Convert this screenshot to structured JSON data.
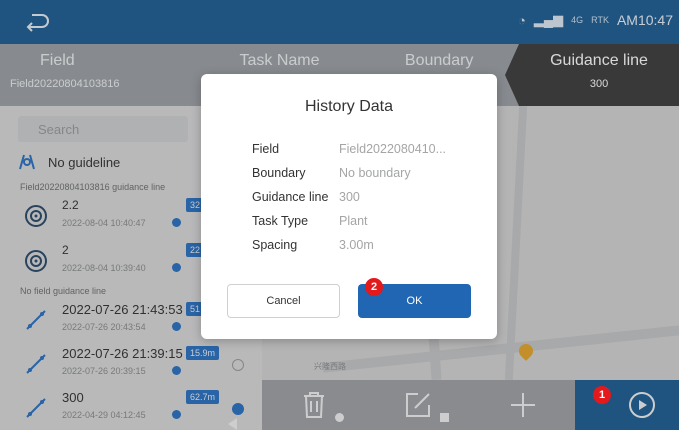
{
  "status": {
    "time": "AM10:47",
    "sig1": "4G",
    "sig2": "RTK"
  },
  "tabs": [
    {
      "label": "Field",
      "value": "Field20220804103816"
    },
    {
      "label": "Task Name",
      "value": ""
    },
    {
      "label": "Boundary",
      "value": ""
    },
    {
      "label": "Guidance line",
      "value": "300"
    }
  ],
  "left": {
    "search_placeholder": "Search",
    "no_guideline": "No guideline",
    "group1": "Field20220804103816 guidance line",
    "group2": "No field guidance line",
    "items": [
      {
        "name": "2.2",
        "date": "2022-08-04 10:40:47",
        "badge": "32"
      },
      {
        "name": "2",
        "date": "2022-08-04 10:39:40",
        "badge": "22"
      },
      {
        "name": "2022-07-26 21:43:53",
        "date": "2022-07-26 20:43:54",
        "badge": "51"
      },
      {
        "name": "2022-07-26 21:39:15",
        "date": "2022-07-26 20:39:15",
        "badge": "15.9m"
      },
      {
        "name": "300",
        "date": "2022-04-29 04:12:45",
        "badge": "62.7m"
      }
    ]
  },
  "map": {
    "road_label": "兴隆西路"
  },
  "dialog": {
    "title": "History Data",
    "rows": [
      {
        "key": "Field",
        "value": "Field2022080410..."
      },
      {
        "key": "Boundary",
        "value": "No boundary"
      },
      {
        "key": "Guidance line",
        "value": "300"
      },
      {
        "key": "Task Type",
        "value": "Plant"
      },
      {
        "key": "Spacing",
        "value": "3.00m"
      }
    ],
    "cancel_label": "Cancel",
    "ok_label": "OK"
  },
  "markers": {
    "m1": "1",
    "m2": "2"
  },
  "colors": {
    "primary": "#1e5e95",
    "button": "#2166b2",
    "marker": "#e3191c"
  },
  "icons": [
    "back-icon",
    "wifi-icon",
    "signal-icon",
    "field-guide-icon",
    "target-icon",
    "line-icon",
    "delete-icon",
    "edit-icon",
    "add-icon",
    "play-icon",
    "globe-icon"
  ]
}
